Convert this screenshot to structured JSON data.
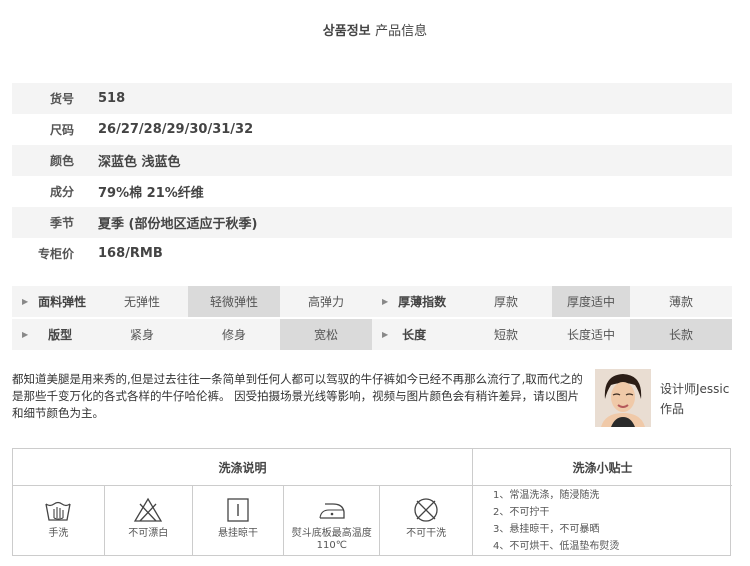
{
  "header": {
    "title_ko": "상품정보",
    "title_zh": "产品信息"
  },
  "specs": [
    {
      "label": "货号",
      "value": "518"
    },
    {
      "label": "尺码",
      "value": "26/27/28/29/30/31/32"
    },
    {
      "label": "颜色",
      "value": "深蓝色 浅蓝色"
    },
    {
      "label": "成分",
      "value": "79%棉  21%纤维"
    },
    {
      "label": "季节",
      "value": "夏季 (部份地区适应于秋季)"
    },
    {
      "label": "专柜价",
      "value": "168/RMB"
    }
  ],
  "features": {
    "elasticity": {
      "label": "面料弹性",
      "options": [
        "无弹性",
        "轻微弹性",
        "高弹力"
      ],
      "selected": "轻微弹性"
    },
    "thickness": {
      "label": "厚薄指数",
      "options": [
        "厚款",
        "厚度适中",
        "薄款"
      ],
      "selected": "厚度适中"
    },
    "fit": {
      "label": "版型",
      "options": [
        "紧身",
        "修身",
        "宽松"
      ],
      "selected": "宽松"
    },
    "length": {
      "label": "长度",
      "options": [
        "短款",
        "长度适中",
        "长款"
      ],
      "selected": "长款"
    }
  },
  "description": "都知道美腿是用来秀的,但是过去往往一条简单到任何人都可以驾驭的牛仔裤如今已经不再那么流行了,取而代之的是那些千变万化的各式各样的牛仔哈伦裤。 因受拍摄场景光线等影响，视频与图片颜色会有稍许差异，请以图片和细节颜色为主。",
  "designer": {
    "line1": "设计师Jessic",
    "line2": "作品"
  },
  "care": {
    "header_left": "洗涤说明",
    "header_right": "洗涤小贴士",
    "icons": [
      {
        "name": "hand-wash-icon",
        "label": "手洗"
      },
      {
        "name": "no-bleach-icon",
        "label": "不可漂白"
      },
      {
        "name": "hang-dry-icon",
        "label": "悬挂晾干"
      },
      {
        "name": "iron-icon",
        "label": "熨斗底板最高温度110℃"
      },
      {
        "name": "no-dry-clean-icon",
        "label": "不可干洗"
      }
    ],
    "tips": [
      "1、常温洗涤，随浸随洗",
      "2、不可拧干",
      "3、悬挂晾干，不可暴晒",
      "4、不可烘干、低温垫布熨烫"
    ]
  }
}
